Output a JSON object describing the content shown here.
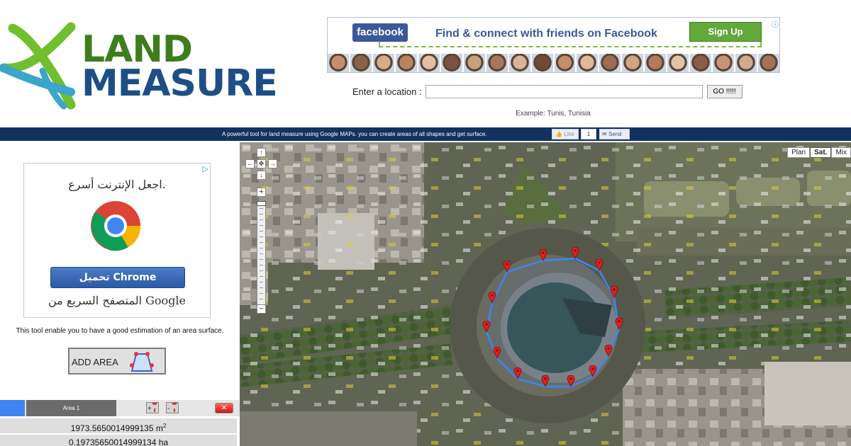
{
  "logo": {
    "line1": "LAND",
    "line2": "MEASURE"
  },
  "facebook_ad": {
    "brand": "facebook",
    "message": "Find & connect with friends on Facebook",
    "signup": "Sign Up",
    "ad_icon": "ⓘ",
    "face_colors": [
      "#c48f6d",
      "#8c6149",
      "#d6ad8b",
      "#b98462",
      "#e0c0a2",
      "#7a5441",
      "#c9a07f",
      "#a8785a",
      "#d8b594",
      "#6e4a37",
      "#c58d68",
      "#deb99a",
      "#9e6c50",
      "#cfa584",
      "#b07c5c",
      "#e2c3a6",
      "#8a5e46",
      "#c69474",
      "#d2ab8e",
      "#a37356"
    ]
  },
  "search": {
    "label": "Enter a location :",
    "value": "",
    "go": "GO !!!!!",
    "example": "Example: Tunis, Tunisia"
  },
  "topbar": {
    "tagline": "A powerful tool for land measure using Google MAPs. you can create areas of all shapes and get surface.",
    "like": "Like",
    "like_count": "1",
    "send": "Send"
  },
  "chrome_ad": {
    "line1": "اجعل الإنترنت أسرع.",
    "button": "تحميل Chrome",
    "line2": "المتصفح السريع من Google",
    "ad_icon": "▷"
  },
  "tool": {
    "description": "This tool enable you to have a good estimation of an area surface.",
    "add_area": "ADD AREA"
  },
  "area": {
    "name": "Area 1",
    "color": "#3f84f3",
    "delete": "✕",
    "m2_value": "1973.5650014999135 m",
    "m2_unit_sup": "2",
    "ha_value": "0.19735650014999134 ha"
  },
  "map": {
    "types": [
      "Plan",
      "Sat.",
      "Mix"
    ],
    "selected_type": "Sat.",
    "pan": {
      "up": "↑",
      "left": "←",
      "center": "✥",
      "right": "→",
      "down": "↓"
    },
    "zoom_in": "+",
    "zoom_out": "−"
  }
}
